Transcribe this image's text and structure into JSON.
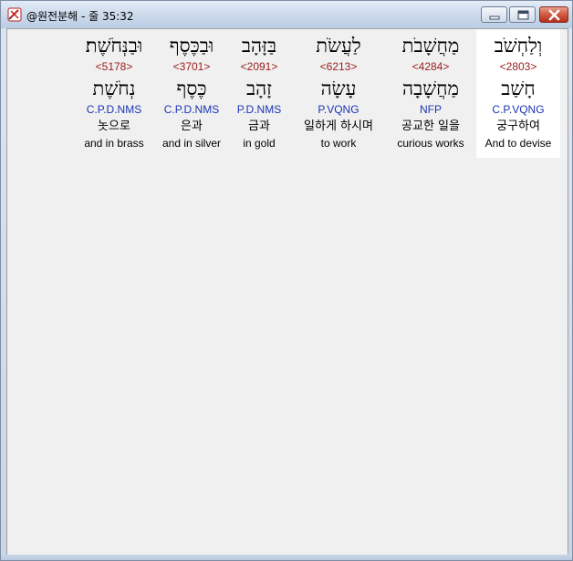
{
  "window": {
    "title": "@원전분해 - 줄 35:32",
    "app_icon": "pen-cross-icon",
    "controls": [
      "minimize-icon",
      "maximize-icon",
      "close-icon"
    ]
  },
  "colors": {
    "strong_number": "#9a1c1c",
    "morphology": "#1c34b4",
    "selected_bg": "#ffffff",
    "panel_bg": "#f0f0f0"
  },
  "words": [
    {
      "hebrew": "וּבַנְּחֹשֶׁת׃",
      "strong": "<5178>",
      "lemma": "נְחֹשֶׁת",
      "morph": "C.P.D.NMS",
      "korean": "놋으로",
      "english": "and in brass",
      "selected": false
    },
    {
      "hebrew": "וּבַכֶּסֶף",
      "strong": "<3701>",
      "lemma": "כֶּסֶף",
      "morph": "C.P.D.NMS",
      "korean": "은과",
      "english": "and in silver",
      "selected": false
    },
    {
      "hebrew": "בַּזָּהָב",
      "strong": "<2091>",
      "lemma": "זָהָב",
      "morph": "P.D.NMS",
      "korean": "금과",
      "english": "in gold",
      "selected": false
    },
    {
      "hebrew": "לַעֲשֹׂת",
      "strong": "<6213>",
      "lemma": "עָשָׂה",
      "morph": "P.VQNG",
      "korean": "일하게 하시며",
      "english": "to work",
      "selected": false
    },
    {
      "hebrew": "מַחֲשָׁבֹת",
      "strong": "<4284>",
      "lemma": "מַחֲשָׁבָה",
      "morph": "NFP",
      "korean": "공교한 일을",
      "english": "curious works",
      "selected": false
    },
    {
      "hebrew": "וְלַחְשֹׁב",
      "strong": "<2803>",
      "lemma": "חָשַׁב",
      "morph": "C.P.VQNG",
      "korean": "궁구하여",
      "english": "And to devise",
      "selected": true
    }
  ]
}
